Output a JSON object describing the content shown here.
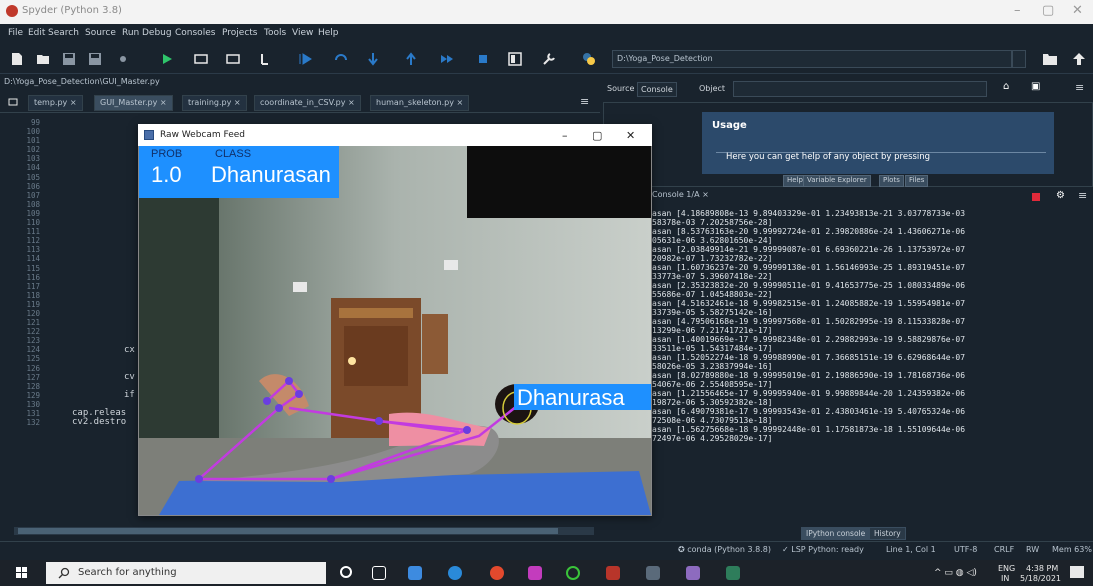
{
  "window": {
    "title": "Spyder (Python 3.8)"
  },
  "menu": [
    "File",
    "Edit",
    "Search",
    "Source",
    "Run",
    "Debug",
    "Consoles",
    "Projects",
    "Tools",
    "View",
    "Help"
  ],
  "toolbar": {
    "working_dir": "D:\\Yoga_Pose_Detection"
  },
  "editor": {
    "file_path": "D:\\Yoga_Pose_Detection\\GUI_Master.py",
    "tabs": [
      {
        "label": "temp.py",
        "active": false
      },
      {
        "label": "GUI_Master.py",
        "active": true
      },
      {
        "label": "training.py",
        "active": false
      },
      {
        "label": "coordinate_in_CSV.py",
        "active": false
      },
      {
        "label": "human_skeleton.py",
        "active": false
      }
    ],
    "line_numbers": [
      "99",
      "100",
      "101",
      "102",
      "103",
      "104",
      "105",
      "106",
      "107",
      "108",
      "109",
      "110",
      "111",
      "112",
      "113",
      "114",
      "115",
      "116",
      "117",
      "118",
      "119",
      "120",
      "121",
      "122",
      "123",
      "124",
      "125",
      "126",
      "127",
      "128",
      "129",
      "130",
      "131",
      "132"
    ],
    "code_fragments": [
      {
        "text": "cx",
        "line": 124
      },
      {
        "text": "cv",
        "line": 127
      },
      {
        "text": "if",
        "line": 129
      },
      {
        "text": "cap.releas",
        "line": 131
      },
      {
        "text": "cv2.destro",
        "line": 132
      }
    ]
  },
  "help_pane": {
    "source_label": "Source",
    "source_value": "Console",
    "object_label": "Object",
    "usage_title": "Usage",
    "usage_text": "Here you can get help of any object by pressing",
    "tabs": [
      "Help",
      "Variable Explorer",
      "Plots",
      "Files"
    ]
  },
  "console": {
    "tab_label": "Console 1/A",
    "lines": [
      "asan [4.18689808e-13 9.89403329e-01 1.23493813e-21 3.03778733e-03",
      "58378e-03 7.20258756e-28]",
      "asan [8.53763163e-20 9.99992724e-01 2.39820886e-24 1.43606271e-06",
      "05631e-06 3.62801650e-24]",
      "asan [2.03849914e-21 9.99999087e-01 6.69360221e-26 1.13753972e-07",
      "20982e-07 1.73232782e-22]",
      "asan [1.60736237e-20 9.99999138e-01 1.56146993e-25 1.89319451e-07",
      "33773e-07 5.39607418e-22]",
      "asan [2.35323832e-20 9.99990511e-01 9.41653775e-25 1.08033489e-06",
      "55686e-07 1.04548803e-22]",
      "asan [4.51632461e-18 9.99982515e-01 1.24085882e-19 1.55954981e-07",
      "33739e-05 5.58275142e-16]",
      "asan [4.79506168e-19 9.99997568e-01 1.50282995e-19 8.11533828e-07",
      "13299e-06 7.21741721e-17]",
      "asan [1.40019669e-17 9.99982348e-01 2.29882993e-19 9.58829876e-07",
      "33511e-05 1.54317484e-17]",
      "asan [1.52052274e-18 9.99988990e-01 7.36685151e-19 6.62968644e-07",
      "58026e-05 3.23837994e-16]",
      "asan [8.02789880e-18 9.99995019e-01 2.19886590e-19 1.78168736e-06",
      "54067e-06 2.55408595e-17]",
      "asan [1.21556465e-17 9.99995940e-01 9.99889844e-20 1.24359382e-06",
      "19872e-06 5.30592382e-18]",
      "asan [6.49079381e-17 9.99993543e-01 2.43803461e-19 5.40765324e-06",
      "72508e-06 4.73079513e-18]",
      "asan [1.56275668e-18 9.99992448e-01 1.17581873e-18 1.55109644e-06",
      "72497e-06 4.29528029e-17]"
    ],
    "bottom_tabs": [
      "IPython console",
      "History"
    ]
  },
  "statusbar": {
    "conda": "conda (Python 3.8.8)",
    "lsp": "LSP Python: ready",
    "position": "Line 1, Col 1",
    "encoding": "UTF-8",
    "eol": "CRLF",
    "rw": "RW",
    "mem": "Mem 63%"
  },
  "taskbar": {
    "search_placeholder": "Search for anything",
    "lang": "ENG",
    "region": "IN",
    "time": "4:38 PM",
    "date": "5/18/2021"
  },
  "webcam": {
    "title": "Raw Webcam Feed",
    "prob_label": "PROB",
    "class_label": "CLASS",
    "prob_value": "1.0",
    "class_value": "Dhanurasan",
    "head_label": "Dhanurasa"
  },
  "colors": {
    "ide_bg": "#19232d",
    "label_blue": "#1e90ff",
    "skeleton": "#c23be0"
  }
}
